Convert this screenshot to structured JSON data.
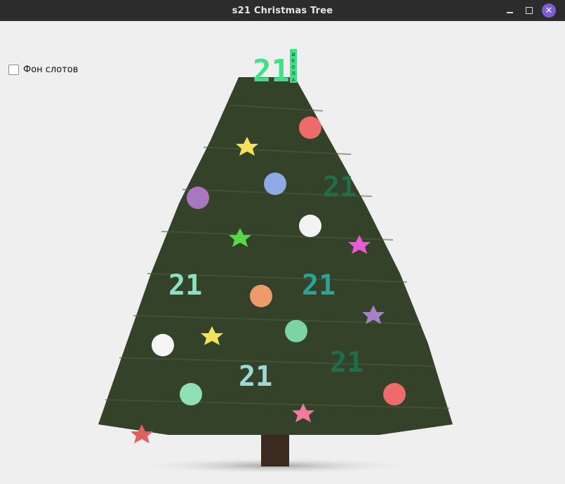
{
  "window": {
    "title": "s21 Christmas Tree"
  },
  "controls": {
    "slot_background_label": "Фон слотов",
    "slot_background_checked": false
  },
  "top_logo": {
    "digits": "21",
    "vertical_text": "ШКОЛА"
  },
  "tree_logos": [
    {
      "digits": "21",
      "color": "#1e6e4a"
    },
    {
      "digits": "21",
      "color": "#8de0c2"
    },
    {
      "digits": "21",
      "color": "#2aa39a"
    },
    {
      "digits": "21",
      "color": "#1e6e4a"
    },
    {
      "digits": "21",
      "color": "#9fd8d8"
    }
  ],
  "colors": {
    "accent_close": "#7f5bd5",
    "titlebar": "#2c2c2c",
    "background": "#efefef",
    "top_logo": "#3ee08a"
  }
}
